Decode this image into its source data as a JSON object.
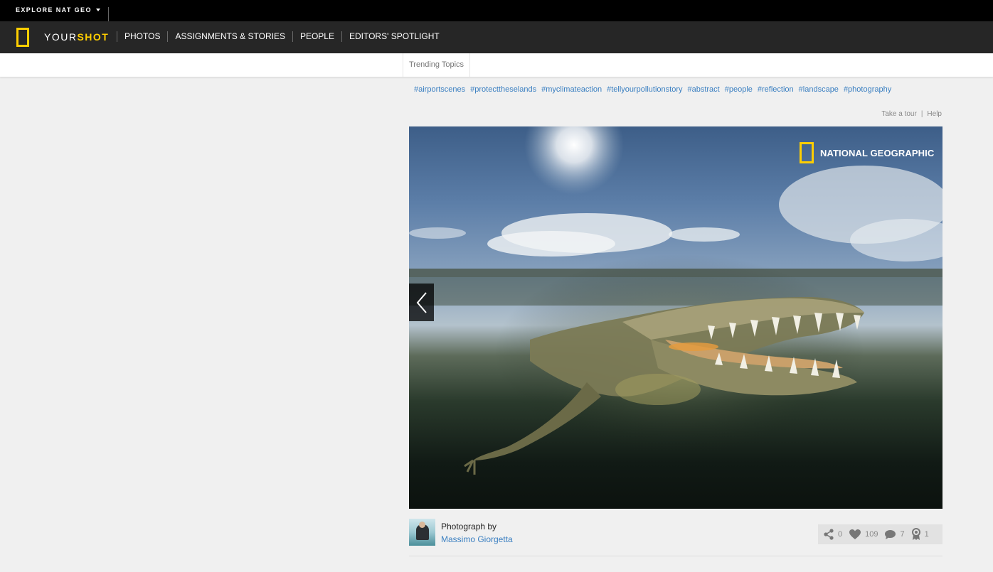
{
  "topbar": {
    "explore_label": "EXPLORE NAT GEO"
  },
  "nav": {
    "brand_your": "YOUR",
    "brand_shot": "SHOT",
    "links": [
      {
        "label": "PHOTOS"
      },
      {
        "label": "ASSIGNMENTS & STORIES"
      },
      {
        "label": "PEOPLE"
      },
      {
        "label": "EDITORS' SPOTLIGHT"
      }
    ]
  },
  "trending": {
    "label": "Trending Topics"
  },
  "hashtags": [
    "#airportscenes",
    "#protecttheselands",
    "#myclimateaction",
    "#tellyourpollutionstory",
    "#abstract",
    "#people",
    "#reflection",
    "#landscape",
    "#photography"
  ],
  "help_links": {
    "tour": "Take a tour",
    "help": "Help"
  },
  "photo": {
    "watermark": "NATIONAL GEOGRAPHIC",
    "icon": "prev-arrow-icon"
  },
  "credit": {
    "label": "Photograph by",
    "author": "Massimo Giorgetta"
  },
  "stats": {
    "shares": "0",
    "likes": "109",
    "comments": "7",
    "awards": "1"
  },
  "colors": {
    "brand_yellow": "#ffce00",
    "link_blue": "#3a7fc1",
    "nav_bg": "#262626"
  }
}
